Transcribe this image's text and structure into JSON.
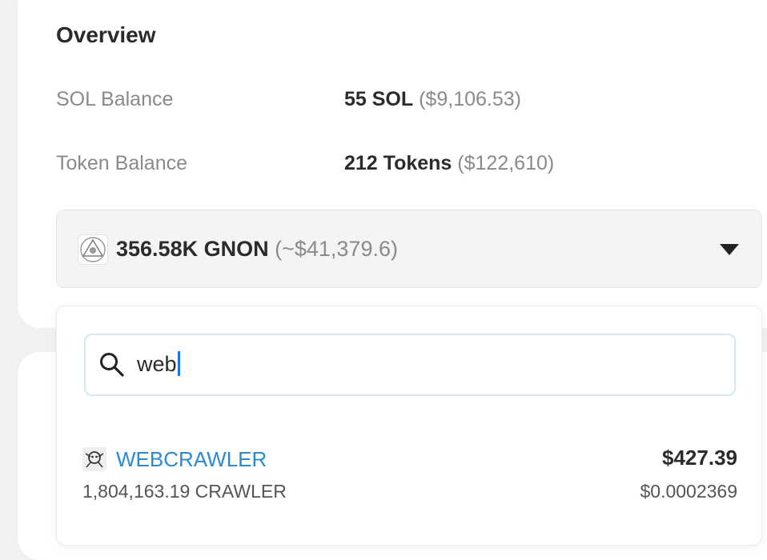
{
  "overview": {
    "title": "Overview",
    "sol_label": "SOL Balance",
    "sol_amount": "55 SOL",
    "sol_usd": "($9,106.53)",
    "token_label": "Token Balance",
    "token_amount": "212 Tokens",
    "token_usd": "($122,610)"
  },
  "token_select": {
    "icon": "gnon-token-logo",
    "amount": "356.58K GNON",
    "usd": "(~$41,379.6)"
  },
  "dropdown": {
    "search_value": "web",
    "results": [
      {
        "icon": "webcrawler-token-logo",
        "name": "WEBCRAWLER",
        "amount": "1,804,163.19 CRAWLER",
        "usd_value": "$427.39",
        "price": "$0.0002369"
      }
    ]
  },
  "colors": {
    "link": "#2a8ad4",
    "search_border": "#d6e7f4",
    "cursor": "#1a73e8"
  }
}
